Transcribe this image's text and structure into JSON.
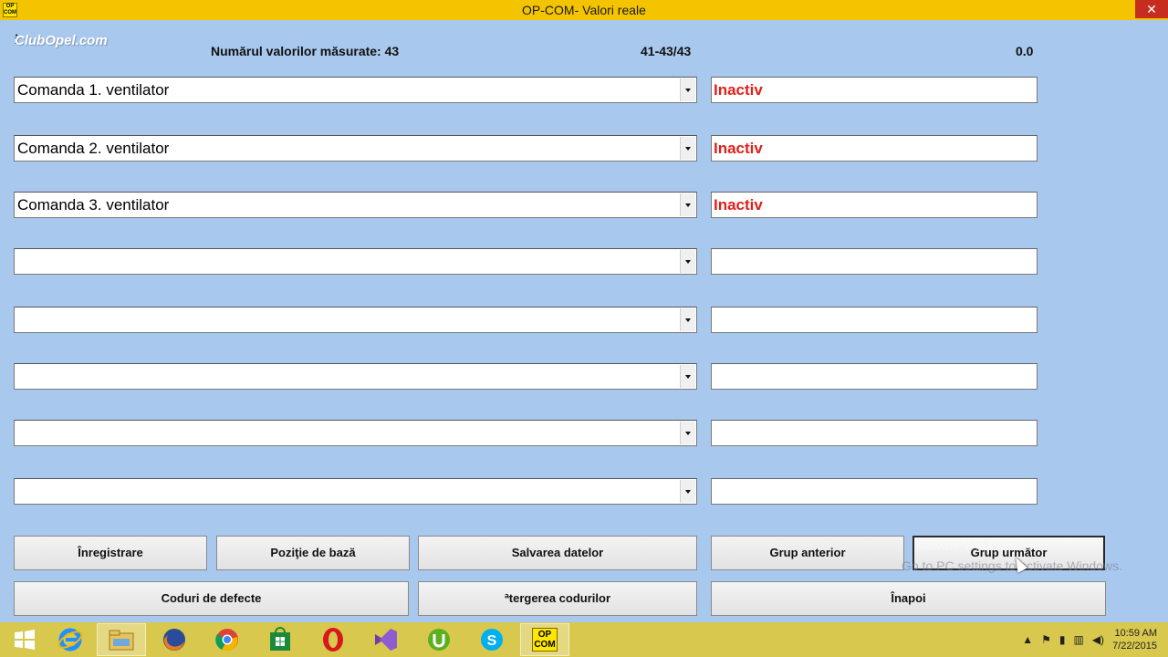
{
  "window": {
    "app_icon_text": "OP COM",
    "title": "OP-COM- Valori reale",
    "close_glyph": "✕"
  },
  "watermark": "ClubOpel.com",
  "info_glyph": "i",
  "header": {
    "measured_values": "Numărul valorilor măsurate: 43",
    "range": "41-43/43",
    "value": "0.0"
  },
  "rows": [
    {
      "label": "Comanda  1. ventilator",
      "value": "Inactiv"
    },
    {
      "label": "Comanda 2. ventilator",
      "value": "Inactiv"
    },
    {
      "label": "Comanda 3. ventilator",
      "value": "Inactiv"
    },
    {
      "label": "",
      "value": ""
    },
    {
      "label": "",
      "value": ""
    },
    {
      "label": "",
      "value": ""
    },
    {
      "label": "",
      "value": ""
    },
    {
      "label": "",
      "value": ""
    }
  ],
  "buttons": {
    "record": "Înregistrare",
    "base_position": "Poziţie de bază",
    "save_data": "Salvarea datelor",
    "prev_group": "Grup anterior",
    "next_group": "Grup următor",
    "fault_codes": "Coduri de defecte",
    "clear_codes": "ªtergerea codurilor",
    "back": "Înapoi"
  },
  "activation_notice": {
    "line1": "Activate Windows",
    "line2": "Go to PC settings to activate Windows."
  },
  "taskbar": {
    "items": [
      "start-button",
      "internet-explorer",
      "file-explorer",
      "firefox",
      "chrome",
      "store",
      "opera",
      "visual-studio",
      "utorrent",
      "skype",
      "op-com"
    ],
    "opcom_label": "OP COM",
    "time": "10:59 AM",
    "date": "7/22/2015"
  },
  "colors": {
    "background": "#a8c8ee",
    "titlebar": "#f5c400",
    "inactive_text": "#e0201a",
    "taskbar": "#d9c84e"
  }
}
